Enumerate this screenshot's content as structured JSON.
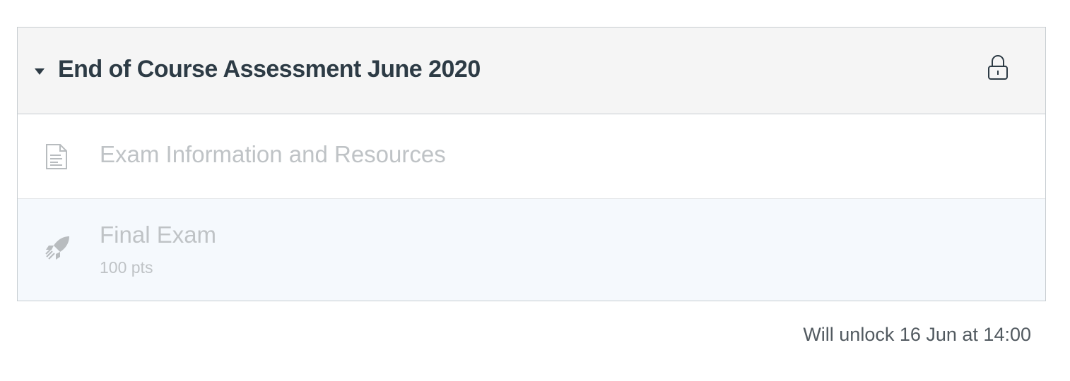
{
  "module": {
    "title": "End of Course Assessment June 2020",
    "collapse_icon": "caret-down-icon",
    "lock_icon": "lock-icon",
    "items": [
      {
        "type": "page",
        "icon": "document-icon",
        "title": "Exam Information and Resources"
      },
      {
        "type": "quiz",
        "icon": "rocket-icon",
        "title": "Final Exam",
        "points": "100 pts"
      }
    ],
    "unlock_note": "Will unlock 16 Jun at 14:00"
  },
  "colors": {
    "header_bg": "#f5f5f5",
    "title_text": "#2d3b45",
    "locked_item_text": "#bfc3c6",
    "highlight_row_bg": "#f5f9fd",
    "border": "#c7cdd1"
  }
}
